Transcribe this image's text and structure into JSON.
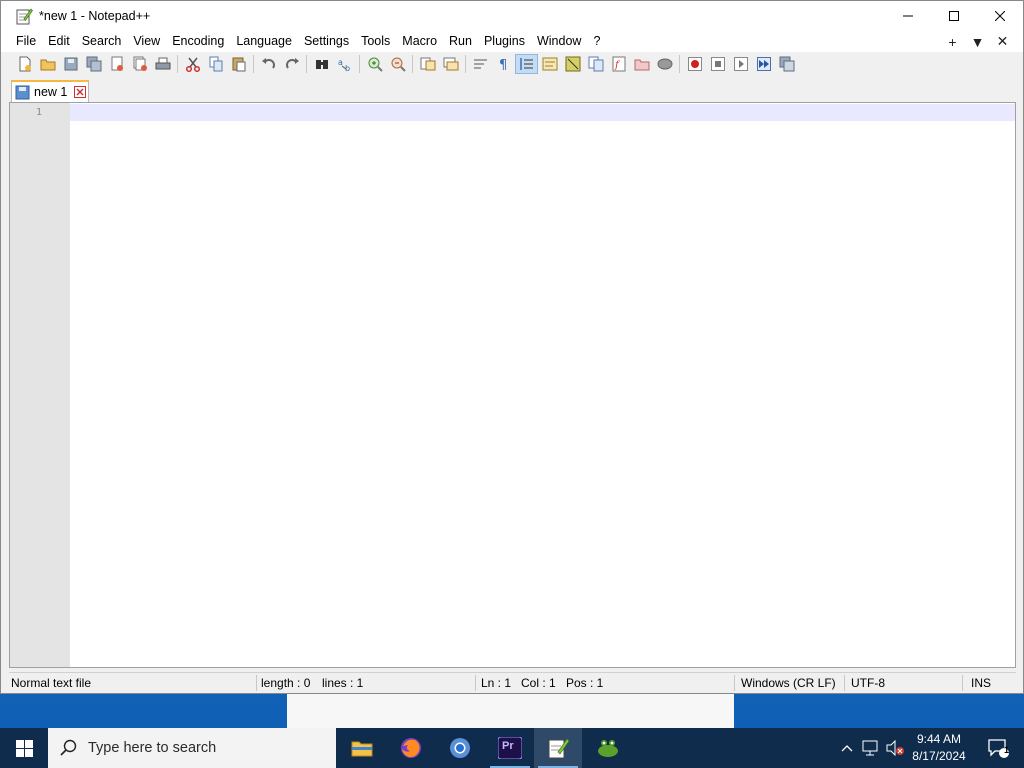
{
  "window": {
    "title": "*new 1 - Notepad++"
  },
  "menu": [
    "File",
    "Edit",
    "Search",
    "View",
    "Encoding",
    "Language",
    "Settings",
    "Tools",
    "Macro",
    "Run",
    "Plugins",
    "Window",
    "?"
  ],
  "menu_right": {
    "add": "+",
    "dropdown": "▼",
    "close": "✕"
  },
  "tabs": [
    {
      "label": "new 1"
    }
  ],
  "editor": {
    "line_numbers": [
      "1"
    ]
  },
  "status": {
    "file_type": "Normal text file",
    "length": "length : 0",
    "lines": "lines : 1",
    "ln": "Ln : 1",
    "col": "Col : 1",
    "pos": "Pos : 1",
    "eol": "Windows (CR LF)",
    "encoding": "UTF-8",
    "mode": "INS"
  },
  "taskbar": {
    "search_placeholder": "Type here to search",
    "apps": [
      "file-explorer",
      "firefox",
      "chromium",
      "premiere-pro",
      "notepad-plus-plus",
      "gimp"
    ],
    "premiere_label": "Pr",
    "time": "9:44 AM",
    "date": "8/17/2024",
    "notification_count": "1"
  },
  "colors": {
    "accent_tab": "#f7b843",
    "current_line": "#e8e8ff",
    "taskbar": "#0f2c4c",
    "desktop": "#1a6fc4"
  }
}
